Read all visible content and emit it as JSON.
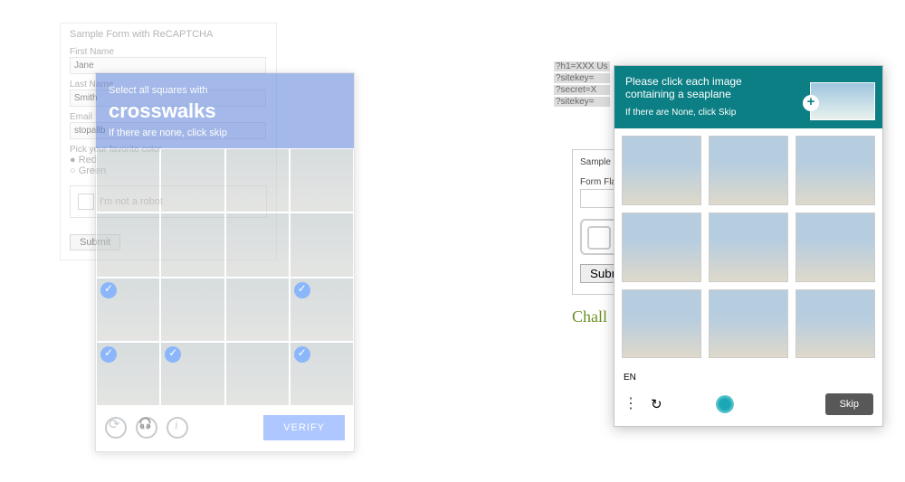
{
  "leftForm": {
    "title": "Sample Form with ReCAPTCHA",
    "firstNameLabel": "First Name",
    "firstNameValue": "Jane",
    "lastNameLabel": "Last Name",
    "lastNameValue": "Smith",
    "emailLabel": "Email",
    "emailValue": "stopallb",
    "pickColorLabel": "Pick your favorite color",
    "colorRed": "Red",
    "colorGreen": "Green",
    "notRobot": "I'm not a robot",
    "submit": "Submit"
  },
  "crosswalkCaptcha": {
    "line1": "Select all squares with",
    "target": "crosswalks",
    "line3": "If there are none, click skip",
    "verify": "VERIFY",
    "tilesSelected": [
      8,
      11,
      12,
      13,
      15
    ]
  },
  "bgLines": {
    "l1": "?h1=XXX Us",
    "l2": "?sitekey=",
    "l3": "?secret=X",
    "l4": "?sitekey="
  },
  "rightCard": {
    "sample": "Sample F",
    "formFlag": "Form Fla",
    "submit": "Submit"
  },
  "chall": "Chall",
  "seaplane": {
    "line1": "Please click each image",
    "line2": "containing a seaplane",
    "sub": "If there are None, click Skip",
    "lang": "EN",
    "skip": "Skip"
  }
}
